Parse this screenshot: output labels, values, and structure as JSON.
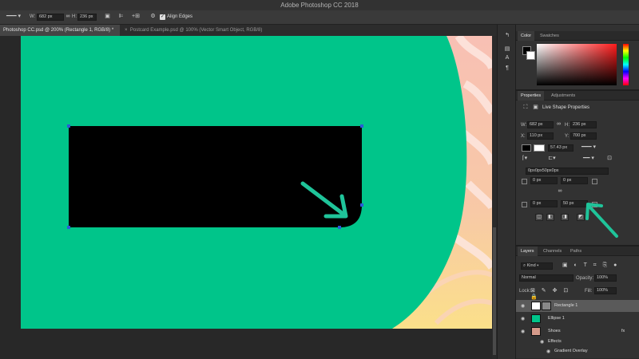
{
  "app": {
    "title": "Adobe Photoshop CC 2018"
  },
  "options_bar": {
    "width_label": "W:",
    "width_value": "682 px",
    "height_label": "H:",
    "height_value": "236 px",
    "align_edges_label": "Align Edges"
  },
  "tabs": [
    {
      "label": "Photoshop CC.psd @ 200% (Rectangle 1, RGB/8) *",
      "active": true
    },
    {
      "label": "Postcard Example.psd @ 100% (Vector Smart Object, RGB/8)",
      "active": false
    }
  ],
  "color_panel": {
    "tabs": [
      "Color",
      "Swatches"
    ]
  },
  "properties_panel": {
    "tabs": [
      "Properties",
      "Adjustments"
    ],
    "section_title": "Live Shape Properties",
    "w_label": "W:",
    "w_value": "682 px",
    "h_label": "H:",
    "h_value": "236 px",
    "x_label": "X:",
    "x_value": "110 px",
    "y_label": "Y:",
    "y_value": "700 px",
    "stroke_width": "57.43 px",
    "corner_summary": "0px0px50px0px",
    "corner_top_left": "0 px",
    "corner_top_right": "0 px",
    "corner_bottom_left": "0 px",
    "corner_bottom_right": "50 px"
  },
  "layers_panel": {
    "tabs": [
      "Layers",
      "Channels",
      "Paths"
    ],
    "filter_kind": "Kind",
    "blend_mode": "Normal",
    "opacity_label": "Opacity:",
    "opacity_value": "100%",
    "lock_label": "Lock:",
    "fill_label": "Fill:",
    "fill_value": "100%",
    "layers": [
      {
        "name": "Rectangle 1",
        "selected": true
      },
      {
        "name": "Ellipse 1",
        "selected": false
      },
      {
        "name": "Shoes",
        "selected": false
      }
    ],
    "effects_label": "Effects",
    "effect_item": "Gradient Overlay",
    "fx_label": "fx"
  },
  "colors": {
    "canvas_green": "#00c58a",
    "annotation_arrow": "#1fc49a",
    "selected_layer": "#5a5a5a"
  }
}
